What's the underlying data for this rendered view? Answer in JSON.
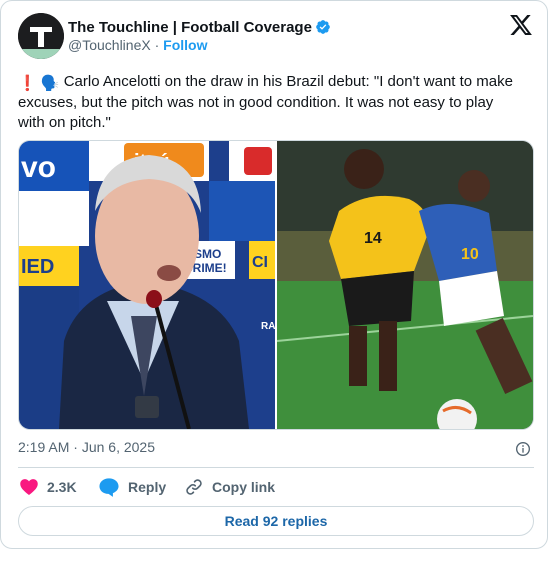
{
  "author": {
    "display_name": "The Touchline | Football Coverage",
    "handle": "@TouchlineX",
    "separator": "·",
    "follow_label": "Follow"
  },
  "tweet": {
    "emoji_1": "❗",
    "emoji_2": "🗣️",
    "text": "Carlo Ancelotti on the draw in his Brazil debut: \"I don't want to make excuses, but the pitch was not in good condition. It was not easy to play with on pitch.\""
  },
  "media": {
    "left_photo": {
      "backdrop_texts": [
        "vo",
        "itaú",
        "IED",
        "CISMO",
        "CRIME!",
        "CI",
        "RA"
      ]
    },
    "right_photo": {
      "shirt_numbers": [
        "14",
        "10"
      ]
    }
  },
  "meta": {
    "time": "2:19 AM",
    "separator": "·",
    "date": "Jun 6, 2025"
  },
  "actions": {
    "like_count": "2.3K",
    "reply_label": "Reply",
    "copy_link_label": "Copy link"
  },
  "footer": {
    "read_replies_label": "Read 92 replies"
  },
  "colors": {
    "accent": "#1d9bf0",
    "like": "#f91880",
    "text": "#0f1419",
    "secondary": "#536471",
    "border": "#cfd9de"
  },
  "icons": [
    "avatar-logo",
    "verified-badge-icon",
    "x-logo-icon",
    "info-icon",
    "heart-icon",
    "reply-bubble-icon",
    "link-icon"
  ]
}
